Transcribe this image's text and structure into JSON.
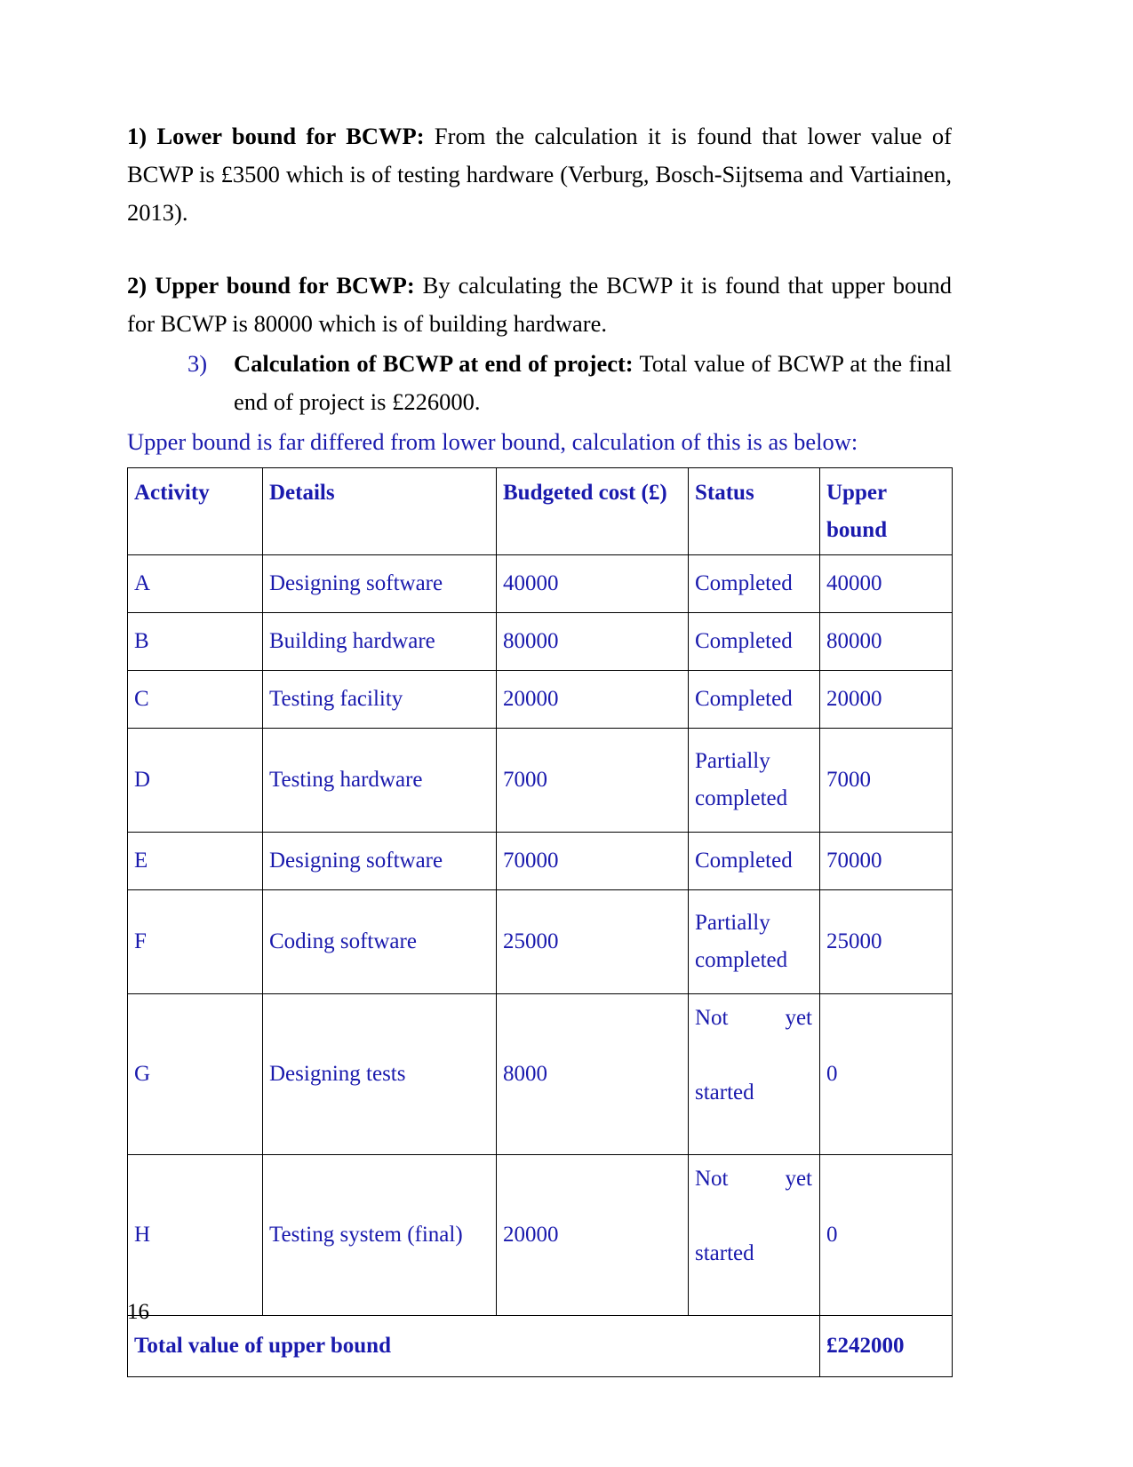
{
  "document": {
    "page_number": "16",
    "accent_blue": "#1a1aad",
    "paragraphs": [
      {
        "id": "p1",
        "label": "1) Lower bound for BCWP:",
        "body": " From the calculation it is found that lower value of BCWP is £3500 which is of testing hardware (Verburg, Bosch-Sijtsema and Vartiainen, 2013)."
      },
      {
        "id": "p2",
        "label": "2) Upper bound for BCWP:",
        "body": " By calculating the BCWP it is found that upper bound for BCWP is 80000 which is of building hardware."
      }
    ],
    "list_item": {
      "marker": "3)",
      "label": "Calculation of BCWP at end of project:",
      "body": " Total value of BCWP at the final end of project is £226000."
    },
    "table_caption": "Upper bound is far differed from lower bound, calculation of this is as below:"
  },
  "table": {
    "headers": [
      "Activity",
      "Details",
      "Budgeted cost (£)",
      "Status",
      "Upper bound"
    ],
    "rows": [
      {
        "activity": "A",
        "details": "Designing software",
        "cost": "40000",
        "status": "Completed",
        "status_line1": "Completed",
        "status_line2": "",
        "upper": "40000",
        "tall": false
      },
      {
        "activity": "B",
        "details": "Building hardware",
        "cost": "80000",
        "status": "Completed",
        "status_line1": "Completed",
        "status_line2": "",
        "upper": "80000",
        "tall": false
      },
      {
        "activity": "C",
        "details": "Testing facility",
        "cost": "20000",
        "status": "Completed",
        "status_line1": "Completed",
        "status_line2": "",
        "upper": "20000",
        "tall": false
      },
      {
        "activity": "D",
        "details": "Testing hardware",
        "cost": "7000",
        "status": "Partially completed",
        "status_line1": "Partially",
        "status_line2": "completed",
        "upper": "7000",
        "tall": true
      },
      {
        "activity": "E",
        "details": "Designing software",
        "cost": "70000",
        "status": "Completed",
        "status_line1": "Completed",
        "status_line2": "",
        "upper": "70000",
        "tall": false
      },
      {
        "activity": "F",
        "details": "Coding software",
        "cost": "25000",
        "status": "Partially completed",
        "status_line1": "Partially",
        "status_line2": "completed",
        "upper": "25000",
        "tall": true
      },
      {
        "activity": "G",
        "details": "Designing tests",
        "cost": "8000",
        "status": "Not yet started",
        "status_line1": "Not yet",
        "status_line2": "started",
        "upper": "0",
        "tall": true,
        "justify": true
      },
      {
        "activity": "H",
        "details": "Testing system (final)",
        "cost": "20000",
        "status": "Not yet started",
        "status_line1": "Not yet",
        "status_line2": "started",
        "upper": "0",
        "tall": true,
        "justify": true
      }
    ],
    "total_row": {
      "label": "Total value of upper bound",
      "value": "£242000"
    }
  }
}
